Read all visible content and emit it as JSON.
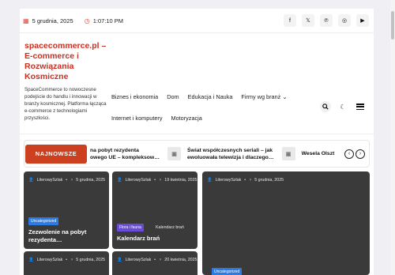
{
  "topbar": {
    "date": "5 grudnia, 2025",
    "time": "1:07:10 PM",
    "socials": [
      {
        "icon": "facebook-icon",
        "glyph": "f"
      },
      {
        "icon": "x-icon",
        "glyph": "𝕏"
      },
      {
        "icon": "pinterest-icon",
        "glyph": "℗"
      },
      {
        "icon": "instagram-icon",
        "glyph": "◎"
      },
      {
        "icon": "youtube-icon",
        "glyph": "▶"
      }
    ]
  },
  "brand": {
    "title": "spacecommerce.pl – E-commerce i Rozwiązania Kosmiczne",
    "description": "SpaceCommerce to nowoczesne podejście do handlu i innowacji w branży kosmicznej. Platforma łącząca e-commerce z technologiami przyszłości."
  },
  "nav": {
    "row1": [
      "Biznes i ekonomia",
      "Dom",
      "Edukacja i Nauka",
      "Firmy wg branż ⌄"
    ],
    "row2": [
      "Internet i komputery",
      "Motoryzacja"
    ]
  },
  "ticker": {
    "label": "NAJNOWSZE",
    "items": [
      {
        "line1": "na pobyt rezydenta",
        "line2": "owego UE – kompleksow…"
      },
      {
        "line1": "Świat współczesnych seriali – jak",
        "line2": "ewoluowała telewizja i dlaczego…"
      },
      {
        "line1": "Wesela Olszt",
        "line2": ""
      }
    ],
    "prev": "‹",
    "next": "›"
  },
  "cards": [
    {
      "author": "LiterowySzlak",
      "date": "5 grudnia, 2025",
      "badge": "Uncategorized",
      "tag": "",
      "title": "Zezwolenie na pobyt rezydenta…"
    },
    {
      "author": "LiterowySzlak",
      "date": "19 kwietnia, 2025",
      "badge": "Flora i fauna",
      "tag": "Kalendarz brań",
      "title": "Kalendarz brań"
    },
    {
      "author": "LiterowySzlak",
      "date": "5 grudnia, 2025",
      "badge": "Uncategorized",
      "tag": "",
      "title": ""
    },
    {
      "author": "LiterowySzlak",
      "date": "5 grudnia, 2025",
      "badge": "",
      "tag": "",
      "title": ""
    },
    {
      "author": "LiterowySzlak",
      "date": "20 kwietnia, 2025",
      "badge": "",
      "tag": "",
      "title": ""
    }
  ]
}
